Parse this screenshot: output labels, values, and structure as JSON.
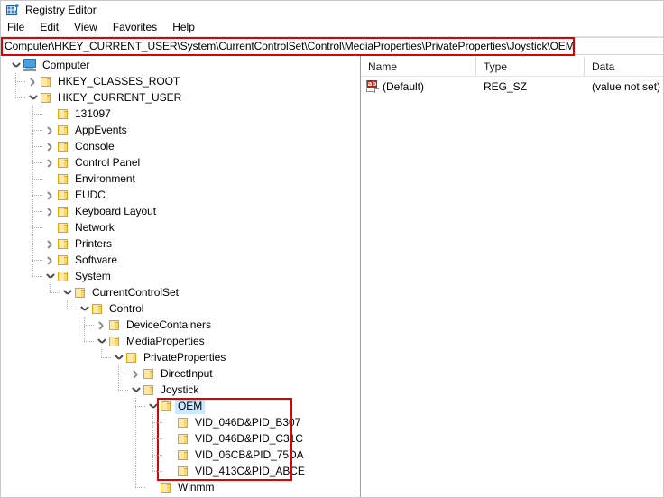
{
  "window": {
    "title": "Registry Editor",
    "icon": "registry-icon"
  },
  "menubar": {
    "items": [
      {
        "label": "File"
      },
      {
        "label": "Edit"
      },
      {
        "label": "View"
      },
      {
        "label": "Favorites"
      },
      {
        "label": "Help"
      }
    ]
  },
  "address_bar": {
    "value": "Computer\\HKEY_CURRENT_USER\\System\\CurrentControlSet\\Control\\MediaProperties\\PrivateProperties\\Joystick\\OEM",
    "highlight_color": "#e00000"
  },
  "tree": {
    "nodes": [
      {
        "label": "Computer",
        "depth": 0,
        "state": "expanded",
        "icon": "computer-icon",
        "selected": false
      },
      {
        "label": "HKEY_CLASSES_ROOT",
        "depth": 1,
        "state": "collapsed",
        "icon": "folder-icon",
        "selected": false
      },
      {
        "label": "HKEY_CURRENT_USER",
        "depth": 1,
        "state": "expanded",
        "icon": "folder-icon",
        "selected": false
      },
      {
        "label": "131097",
        "depth": 2,
        "state": "leaf",
        "icon": "folder-icon",
        "selected": false
      },
      {
        "label": "AppEvents",
        "depth": 2,
        "state": "collapsed",
        "icon": "folder-icon",
        "selected": false
      },
      {
        "label": "Console",
        "depth": 2,
        "state": "collapsed",
        "icon": "folder-icon",
        "selected": false
      },
      {
        "label": "Control Panel",
        "depth": 2,
        "state": "collapsed",
        "icon": "folder-icon",
        "selected": false
      },
      {
        "label": "Environment",
        "depth": 2,
        "state": "leaf",
        "icon": "folder-icon",
        "selected": false
      },
      {
        "label": "EUDC",
        "depth": 2,
        "state": "collapsed",
        "icon": "folder-icon",
        "selected": false
      },
      {
        "label": "Keyboard Layout",
        "depth": 2,
        "state": "collapsed",
        "icon": "folder-icon",
        "selected": false
      },
      {
        "label": "Network",
        "depth": 2,
        "state": "leaf",
        "icon": "folder-icon",
        "selected": false
      },
      {
        "label": "Printers",
        "depth": 2,
        "state": "collapsed",
        "icon": "folder-icon",
        "selected": false
      },
      {
        "label": "Software",
        "depth": 2,
        "state": "collapsed",
        "icon": "folder-icon",
        "selected": false
      },
      {
        "label": "System",
        "depth": 2,
        "state": "expanded",
        "icon": "folder-icon",
        "selected": false
      },
      {
        "label": "CurrentControlSet",
        "depth": 3,
        "state": "expanded",
        "icon": "folder-icon",
        "selected": false
      },
      {
        "label": "Control",
        "depth": 4,
        "state": "expanded",
        "icon": "folder-icon",
        "selected": false
      },
      {
        "label": "DeviceContainers",
        "depth": 5,
        "state": "collapsed",
        "icon": "folder-icon",
        "selected": false
      },
      {
        "label": "MediaProperties",
        "depth": 5,
        "state": "expanded",
        "icon": "folder-icon",
        "selected": false
      },
      {
        "label": "PrivateProperties",
        "depth": 6,
        "state": "expanded",
        "icon": "folder-icon",
        "selected": false
      },
      {
        "label": "DirectInput",
        "depth": 7,
        "state": "collapsed",
        "icon": "folder-icon",
        "selected": false
      },
      {
        "label": "Joystick",
        "depth": 7,
        "state": "expanded",
        "icon": "folder-icon",
        "selected": false
      },
      {
        "label": "OEM",
        "depth": 8,
        "state": "expanded",
        "icon": "folder-icon",
        "selected": true
      },
      {
        "label": "VID_046D&PID_B307",
        "depth": 9,
        "state": "leaf",
        "icon": "folder-icon",
        "selected": false
      },
      {
        "label": "VID_046D&PID_C31C",
        "depth": 9,
        "state": "leaf",
        "icon": "folder-icon",
        "selected": false
      },
      {
        "label": "VID_06CB&PID_75DA",
        "depth": 9,
        "state": "leaf",
        "icon": "folder-icon",
        "selected": false
      },
      {
        "label": "VID_413C&PID_ABCE",
        "depth": 9,
        "state": "leaf",
        "icon": "folder-icon",
        "selected": false
      },
      {
        "label": "Winmm",
        "depth": 8,
        "state": "leaf",
        "icon": "folder-icon",
        "selected": false
      }
    ],
    "highlight_color": "#e00000",
    "selection_color": "#cde8ff"
  },
  "value_list": {
    "columns": [
      {
        "label": "Name"
      },
      {
        "label": "Type"
      },
      {
        "label": "Data"
      }
    ],
    "rows": [
      {
        "icon": "string-value-icon",
        "name": "(Default)",
        "type": "REG_SZ",
        "data": "(value not set)"
      }
    ]
  }
}
